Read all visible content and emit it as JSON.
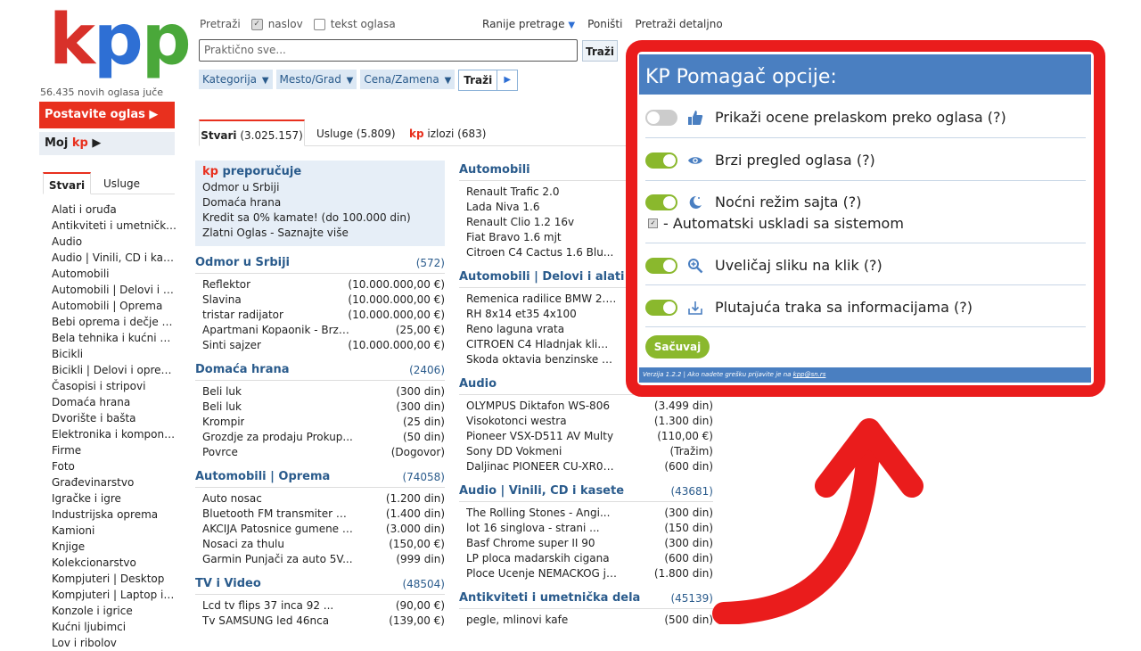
{
  "logo": {
    "k": "k",
    "p1": "p",
    "p2": "p"
  },
  "left": {
    "new_ads": "56.435 novih oglasa juče",
    "post_ad": "Postavite oglas ▶",
    "my_kp_prefix": "Moj ",
    "my_kp_kp": "kp",
    "my_kp_arrow": " ▶",
    "tabs": [
      "Stvari",
      "Usluge"
    ],
    "categories": [
      "Alati i oruđa",
      "Antikviteti i umetnička...",
      "Audio",
      "Audio | Vinili, CD i kas...",
      "Automobili",
      "Automobili | Delovi i a...",
      "Automobili | Oprema",
      "Bebi oprema i dečje st...",
      "Bela tehnika i kućni ap...",
      "Bicikli",
      "Bicikli | Delovi i oprema",
      "Časopisi i stripovi",
      "Domaća hrana",
      "Dvorište i bašta",
      "Elektronika i kompone...",
      "Firme",
      "Foto",
      "Građevinarstvo",
      "Igračke i igre",
      "Industrijska oprema",
      "Kamioni",
      "Knjige",
      "Kolekcionarstvo",
      "Kompjuteri | Desktop",
      "Kompjuteri | Laptop i t...",
      "Konzole i igrice",
      "Kućni ljubimci",
      "Lov i ribolov"
    ]
  },
  "search": {
    "label": "Pretraži",
    "opt_title": "naslov",
    "opt_text": "tekst oglasa",
    "prev": "Ranije pretrage",
    "reset": "Poništi",
    "detailed": "Pretraži detaljno",
    "placeholder": "Praktično sve...",
    "button": "Traži",
    "filters": [
      "Kategorija",
      "Mesto/Grad",
      "Cena/Zamena"
    ],
    "filter_go": "Traži"
  },
  "main_tabs": {
    "t1_label": "Stvari",
    "t1_count": " (3.025.157)",
    "t2": "Usluge (5.809)",
    "t3_kp": "kp",
    "t3_rest": " izlozi (683)"
  },
  "reco": {
    "kp": "kp",
    "title": " preporučuje",
    "items": [
      "Odmor u Srbiji",
      "Domaća hrana",
      "Kredit sa 0% kamate! (do 100.000 din)",
      "Zlatni Oglas - Saznajte više"
    ]
  },
  "col1": [
    {
      "title": "Odmor u Srbiji",
      "count": "(572)",
      "rows": [
        [
          "Reflektor",
          "(10.000.000,00 €)"
        ],
        [
          "Slavina",
          "(10.000.000,00 €)"
        ],
        [
          "tristar radijator",
          "(10.000.000,00 €)"
        ],
        [
          "Apartmani Kopaonik - Brze...",
          "(25,00 €)"
        ],
        [
          "Sinti sajzer",
          "(10.000.000,00 €)"
        ]
      ]
    },
    {
      "title": "Domaća hrana",
      "count": "(2406)",
      "rows": [
        [
          "Beli luk",
          "(300 din)"
        ],
        [
          "Beli luk",
          "(300 din)"
        ],
        [
          "Krompir",
          "(25 din)"
        ],
        [
          "Grozdje za prodaju Prokup...",
          "(50 din)"
        ],
        [
          "Povrce",
          "(Dogovor)"
        ]
      ]
    },
    {
      "title": "Automobili | Oprema",
      "count": "(74058)",
      "rows": [
        [
          "Auto nosac",
          "(1.200 din)"
        ],
        [
          "Bluetooth FM transmiter m...",
          "(1.400 din)"
        ],
        [
          "AKCIJA Patosnice gumene P...",
          "(3.000 din)"
        ],
        [
          "Nosaci za thulu",
          "(150,00 €)"
        ],
        [
          "Garmin Punjači za auto 5V...",
          "(999 din)"
        ]
      ]
    },
    {
      "title": "TV i Video",
      "count": "(48504)",
      "rows": [
        [
          "Lcd tv flips 37 inca 92 ...",
          "(90,00 €)"
        ],
        [
          "Tv SAMSUNG led 46nca",
          "(139,00 €)"
        ]
      ]
    }
  ],
  "col2": [
    {
      "title": "Automobili",
      "count": "",
      "rows": [
        [
          "Renault Trafic 2.0",
          ""
        ],
        [
          "Lada Niva 1.6",
          ""
        ],
        [
          "Renault Clio 1.2 16v",
          ""
        ],
        [
          "Fiat Bravo 1.6 mjt",
          ""
        ],
        [
          "Citroen C4 Cactus 1.6 Blu...",
          ""
        ]
      ]
    },
    {
      "title": "Automobili | Delovi i alati",
      "count": "",
      "rows": [
        [
          "Remenica radilice BMW 2.0...",
          ""
        ],
        [
          "RH 8x14 et35 4x100",
          ""
        ],
        [
          "Reno laguna vrata",
          ""
        ],
        [
          "CITROEN C4 Hladnjak klime...",
          ""
        ],
        [
          "Skoda oktavia benzinske d...",
          ""
        ]
      ]
    },
    {
      "title": "Audio",
      "count": "",
      "rows": [
        [
          "OLYMPUS Diktafon WS-806",
          "(3.499 din)"
        ],
        [
          "Visokotonci westra",
          "(1.300 din)"
        ],
        [
          "Pioneer VSX-D511 AV Multy",
          "(110,00 €)"
        ],
        [
          "Sony DD Vokmeni",
          "(Tražim)"
        ],
        [
          "Daljinac PIONEER CU-XR038...",
          "(600 din)"
        ]
      ]
    },
    {
      "title": "Audio | Vinili, CD i kasete",
      "count": "(43681)",
      "rows": [
        [
          "The Rolling Stones - Angi...",
          "(300 din)"
        ],
        [
          "lot 16 singlova - strani ...",
          "(150 din)"
        ],
        [
          "Basf Chrome super II 90",
          "(300 din)"
        ],
        [
          "LP ploca madarskih cigana",
          "(600 din)"
        ],
        [
          "Ploce Ucenje NEMACKOG jez...",
          "(1.800 din)"
        ]
      ]
    },
    {
      "title": "Antikviteti i umetnička dela",
      "count": "(45139)",
      "rows": [
        [
          "pegle, mlinovi kafe",
          "(500 din)"
        ]
      ]
    }
  ],
  "panel": {
    "title": "KP Pomagač opcije:",
    "options": [
      {
        "label": "Prikaži ocene prelaskom preko oglasa (?)",
        "icon": "thumbs-up-icon",
        "on": false
      },
      {
        "label": "Brzi pregled oglasa (?)",
        "icon": "eye-icon",
        "on": true
      },
      {
        "label": "Noćni režim sajta (?)",
        "icon": "moon-icon",
        "on": true
      },
      {
        "label": "Uveličaj sliku na klik (?)",
        "icon": "zoom-icon",
        "on": true
      },
      {
        "label": "Plutajuća traka sa informacijama (?)",
        "icon": "download-icon",
        "on": true
      }
    ],
    "sub_option": "- Automatski uskladi sa sistemom",
    "save": "Sačuvaj",
    "footer_text": "Verzija 1.2.2 | Ako nadete grešku prijavite je na ",
    "footer_email": "kpp@sn.rs"
  },
  "colors": {
    "accent": "#e8301e",
    "link_blue": "#2a5b8c",
    "panel_blue": "#4a7fc1",
    "toggle_green": "#8ab82d",
    "frame_red": "#ea1c1c"
  }
}
